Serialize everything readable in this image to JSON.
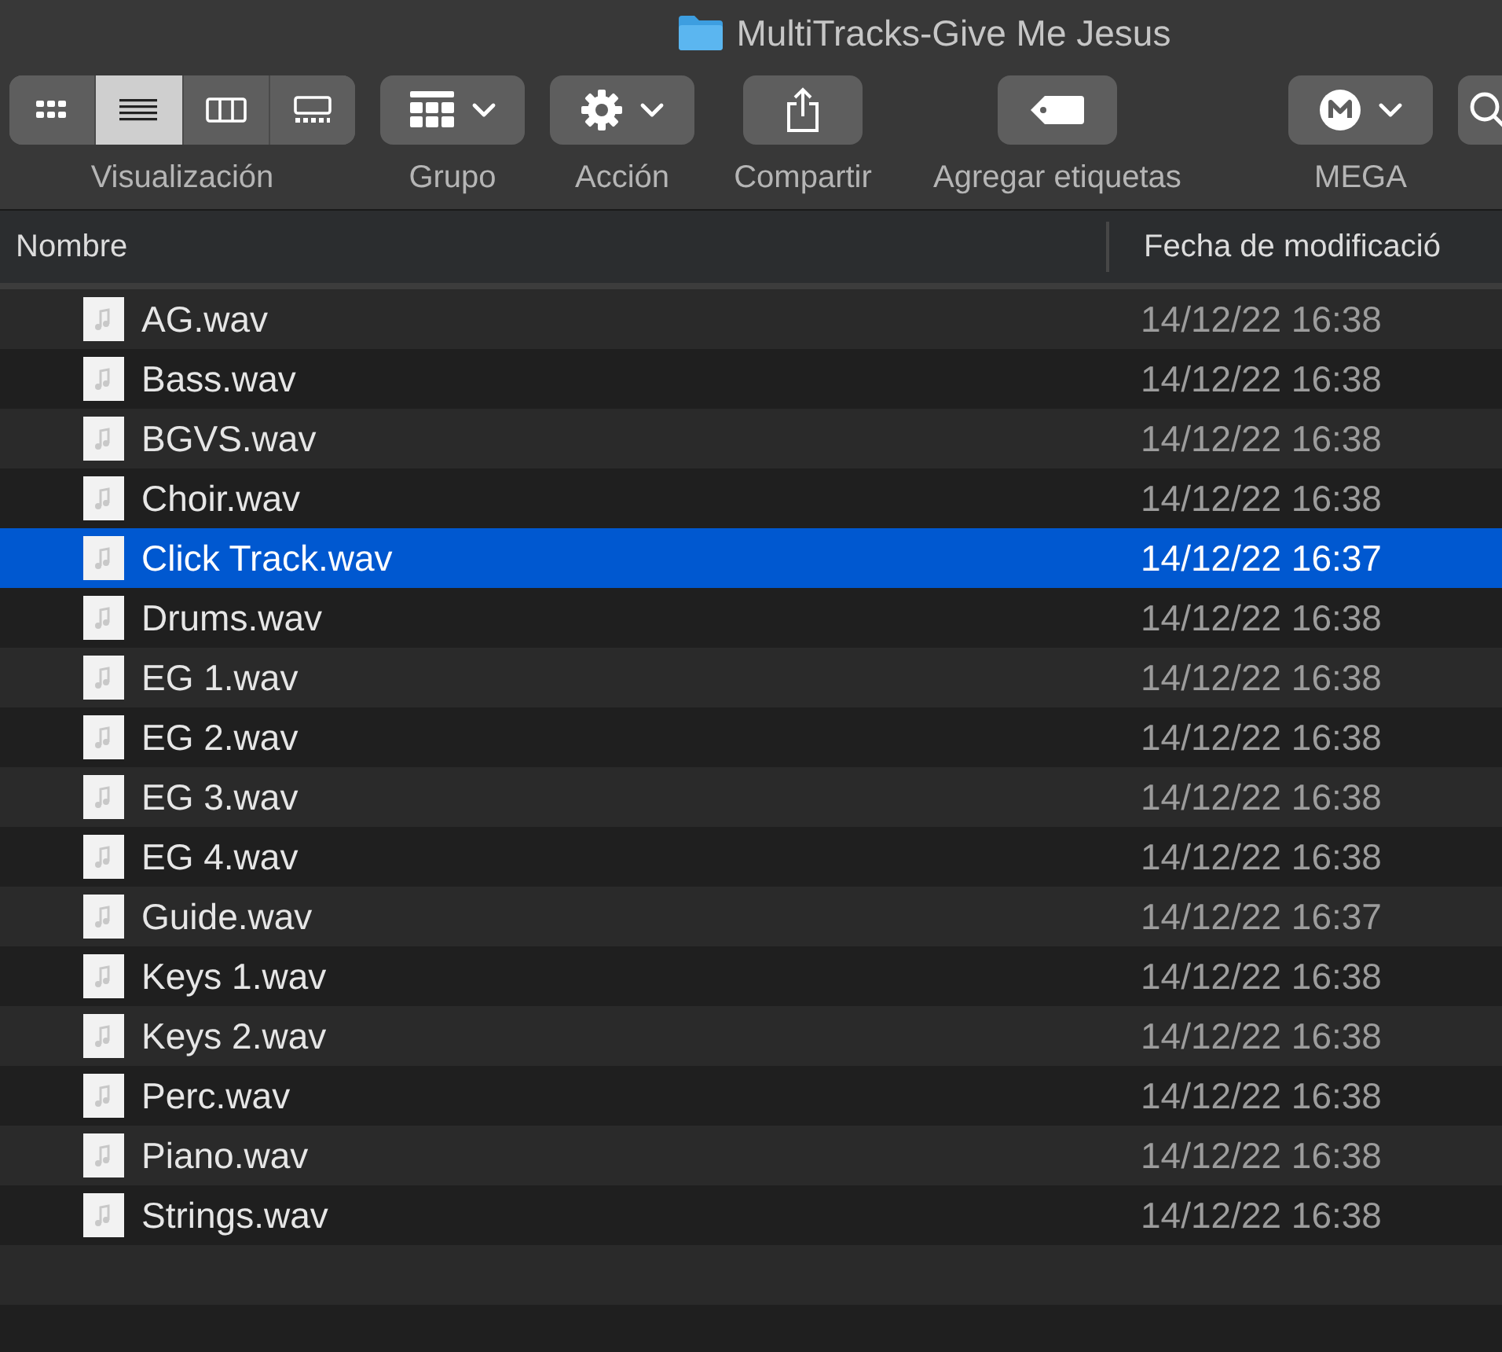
{
  "window": {
    "title": "MultiTracks-Give Me Jesus"
  },
  "toolbar": [
    {
      "kind": "segmented",
      "label": "Visualización",
      "segments": [
        {
          "selected": false
        },
        {
          "selected": true
        },
        {
          "selected": false
        },
        {
          "selected": false
        }
      ]
    },
    {
      "kind": "menu",
      "label": "Grupo"
    },
    {
      "kind": "menu",
      "label": "Acción"
    },
    {
      "kind": "plain",
      "label": "Compartir"
    },
    {
      "kind": "plain",
      "label": "Agregar etiquetas"
    },
    {
      "kind": "menu",
      "label": "MEGA"
    },
    {
      "kind": "search"
    }
  ],
  "table": {
    "columns": [
      "Nombre",
      "Fecha de modificació"
    ],
    "rows": [
      {
        "name": "AG.wav",
        "date": "14/12/22 16:38",
        "selected": false
      },
      {
        "name": "Bass.wav",
        "date": "14/12/22 16:38",
        "selected": false
      },
      {
        "name": "BGVS.wav",
        "date": "14/12/22 16:38",
        "selected": false
      },
      {
        "name": "Choir.wav",
        "date": "14/12/22 16:38",
        "selected": false
      },
      {
        "name": "Click Track.wav",
        "date": "14/12/22 16:37",
        "selected": true
      },
      {
        "name": "Drums.wav",
        "date": "14/12/22 16:38",
        "selected": false
      },
      {
        "name": "EG 1.wav",
        "date": "14/12/22 16:38",
        "selected": false
      },
      {
        "name": "EG 2.wav",
        "date": "14/12/22 16:38",
        "selected": false
      },
      {
        "name": "EG 3.wav",
        "date": "14/12/22 16:38",
        "selected": false
      },
      {
        "name": "EG 4.wav",
        "date": "14/12/22 16:38",
        "selected": false
      },
      {
        "name": "Guide.wav",
        "date": "14/12/22 16:37",
        "selected": false
      },
      {
        "name": "Keys 1.wav",
        "date": "14/12/22 16:38",
        "selected": false
      },
      {
        "name": "Keys 2.wav",
        "date": "14/12/22 16:38",
        "selected": false
      },
      {
        "name": "Perc.wav",
        "date": "14/12/22 16:38",
        "selected": false
      },
      {
        "name": "Piano.wav",
        "date": "14/12/22 16:38",
        "selected": false
      },
      {
        "name": "Strings.wav",
        "date": "14/12/22 16:38",
        "selected": false
      }
    ]
  }
}
